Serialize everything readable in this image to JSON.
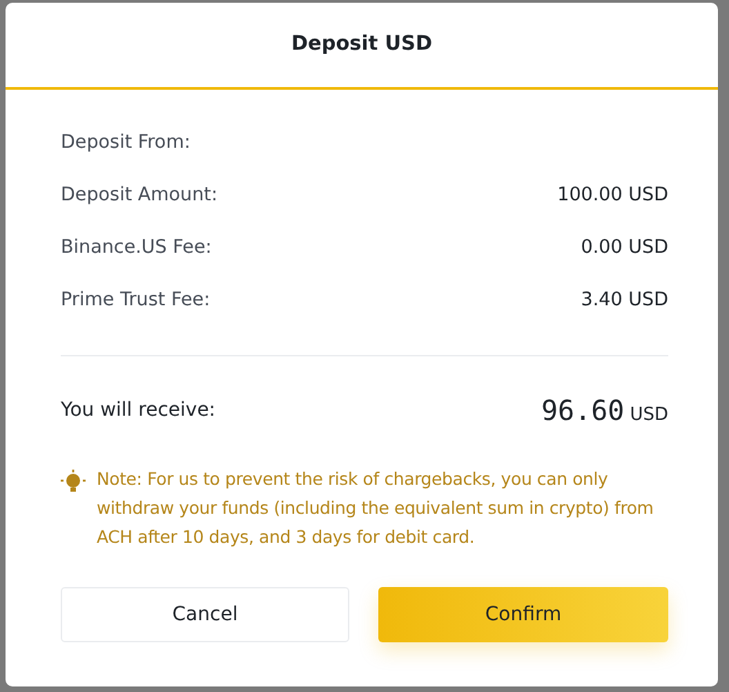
{
  "dialog": {
    "title": "Deposit USD"
  },
  "details": [
    {
      "label": "Deposit From:"
    },
    {
      "label": "Deposit Amount:",
      "value": "100.00 USD"
    },
    {
      "label": "Binance.US Fee:",
      "value": "0.00 USD"
    },
    {
      "label": "Prime Trust Fee:",
      "value": "3.40 USD"
    }
  ],
  "receive": {
    "label": "You will receive:",
    "amount": "96.60",
    "currency": "USD"
  },
  "note": "Note: For us to prevent the risk of chargebacks, you can only withdraw your funds (including the equivalent sum in crypto) from ACH after 10 days, and 3 days for debit card.",
  "buttons": [
    {
      "label": "Cancel",
      "kind": "secondary"
    },
    {
      "label": "Confirm",
      "kind": "primary"
    }
  ]
}
